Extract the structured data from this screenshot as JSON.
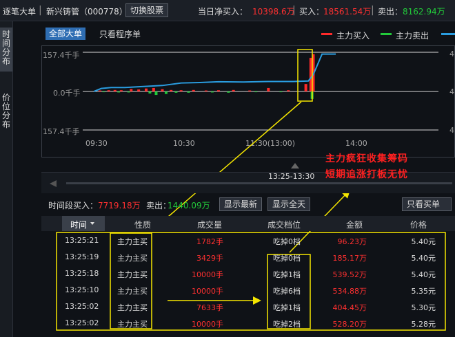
{
  "topbar": {
    "title": "逐笔大单",
    "stock": "新兴铸管（000778）",
    "switch_button": "切换股票",
    "net_buy_label": "当日净买入：",
    "net_buy_value": "10398.6万",
    "buy_label": "买入：",
    "buy_value": "18561.54万",
    "sell_label": "卖出：",
    "sell_value": "8162.94万"
  },
  "side_tabs": [
    {
      "label": "时间分布"
    },
    {
      "label": "价位分布"
    }
  ],
  "filters": {
    "all_big": "全部大单",
    "program_only": "只看程序单"
  },
  "legend": {
    "main_buy": "主力买入",
    "main_sell": "主力卖出"
  },
  "colors": {
    "buy": "#ff2a2a",
    "sell": "#22c93a",
    "line": "#2a9de0",
    "annotation": "#f5e600"
  },
  "chart_data": {
    "type": "bar",
    "y_labels": [
      "157.4千手",
      "0.0千手",
      "157.4千手"
    ],
    "right_labels": [
      "4.",
      "4.",
      "4."
    ],
    "x_labels": [
      "09:30",
      "10:30",
      "11:30(13:00)",
      "14:00"
    ],
    "y_range": [
      -157.4,
      157.4
    ],
    "x_range_minutes": [
      0,
      240
    ],
    "buy_bars": [
      {
        "t": 5,
        "v": 4
      },
      {
        "t": 12,
        "v": 5
      },
      {
        "t": 17,
        "v": 6
      },
      {
        "t": 22,
        "v": 5
      },
      {
        "t": 30,
        "v": 10
      },
      {
        "t": 36,
        "v": 8
      },
      {
        "t": 42,
        "v": 12
      },
      {
        "t": 48,
        "v": 14
      },
      {
        "t": 55,
        "v": 9
      },
      {
        "t": 62,
        "v": 6
      },
      {
        "t": 70,
        "v": 5
      },
      {
        "t": 80,
        "v": 6
      },
      {
        "t": 90,
        "v": 4
      },
      {
        "t": 100,
        "v": 5
      },
      {
        "t": 112,
        "v": 6
      },
      {
        "t": 125,
        "v": 4
      },
      {
        "t": 140,
        "v": 14
      },
      {
        "t": 156,
        "v": 5
      },
      {
        "t": 170,
        "v": 30
      },
      {
        "t": 174,
        "v": 135
      },
      {
        "t": 176,
        "v": 150
      }
    ],
    "sell_bars": [
      {
        "t": 8,
        "v": 3
      },
      {
        "t": 20,
        "v": 4
      },
      {
        "t": 28,
        "v": 4
      },
      {
        "t": 45,
        "v": 8
      },
      {
        "t": 50,
        "v": 14
      },
      {
        "t": 58,
        "v": 10
      },
      {
        "t": 66,
        "v": 5
      },
      {
        "t": 76,
        "v": 5
      },
      {
        "t": 95,
        "v": 4
      },
      {
        "t": 108,
        "v": 5
      },
      {
        "t": 130,
        "v": 3
      },
      {
        "t": 150,
        "v": 3
      },
      {
        "t": 175,
        "v": 30
      }
    ],
    "net_line": [
      {
        "t": 0,
        "v": 0
      },
      {
        "t": 6,
        "v": 12
      },
      {
        "t": 14,
        "v": 16
      },
      {
        "t": 25,
        "v": 16
      },
      {
        "t": 40,
        "v": 20
      },
      {
        "t": 55,
        "v": 24
      },
      {
        "t": 70,
        "v": 34
      },
      {
        "t": 85,
        "v": 36
      },
      {
        "t": 100,
        "v": 39
      },
      {
        "t": 120,
        "v": 38
      },
      {
        "t": 140,
        "v": 40
      },
      {
        "t": 160,
        "v": 40
      },
      {
        "t": 172,
        "v": 42
      },
      {
        "t": 176,
        "v": 68
      },
      {
        "t": 180,
        "v": 115
      },
      {
        "t": 183,
        "v": 150
      },
      {
        "t": 194,
        "v": 150
      }
    ]
  },
  "range": {
    "label": "13:25-13:30"
  },
  "summary": {
    "buy_label": "时间段买入：",
    "buy_value": "7719.18万",
    "sell_label": "卖出：",
    "sell_value": "1440.09万",
    "show_latest": "显示最新",
    "show_all_day": "显示全天",
    "buy_only": "只看买单"
  },
  "table": {
    "headers": [
      "时间",
      "性质",
      "成交量",
      "成交档位",
      "金额",
      "价格"
    ],
    "rows": [
      {
        "time": "13:25:21",
        "nature": "主力主买",
        "volume": "1782手",
        "level": "吃掉0档",
        "amount": "96.23万",
        "price": "5.40元"
      },
      {
        "time": "13:25:19",
        "nature": "主力主买",
        "volume": "3429手",
        "level": "吃掉0档",
        "amount": "185.17万",
        "price": "5.40元"
      },
      {
        "time": "13:25:18",
        "nature": "主力主买",
        "volume": "10000手",
        "level": "吃掉1档",
        "amount": "539.52万",
        "price": "5.40元"
      },
      {
        "time": "13:25:10",
        "nature": "主力主买",
        "volume": "10000手",
        "level": "吃掉6档",
        "amount": "534.88万",
        "price": "5.35元"
      },
      {
        "time": "13:25:02",
        "nature": "主力主买",
        "volume": "7633手",
        "level": "吃掉1档",
        "amount": "404.45万",
        "price": "5.30元"
      },
      {
        "time": "13:25:02",
        "nature": "主力主买",
        "volume": "10000手",
        "level": "吃掉2档",
        "amount": "528.20万",
        "price": "5.28元"
      }
    ]
  },
  "annotation": {
    "line1": "主力疯狂收集筹码",
    "line2": "短期追涨打板无忧"
  }
}
